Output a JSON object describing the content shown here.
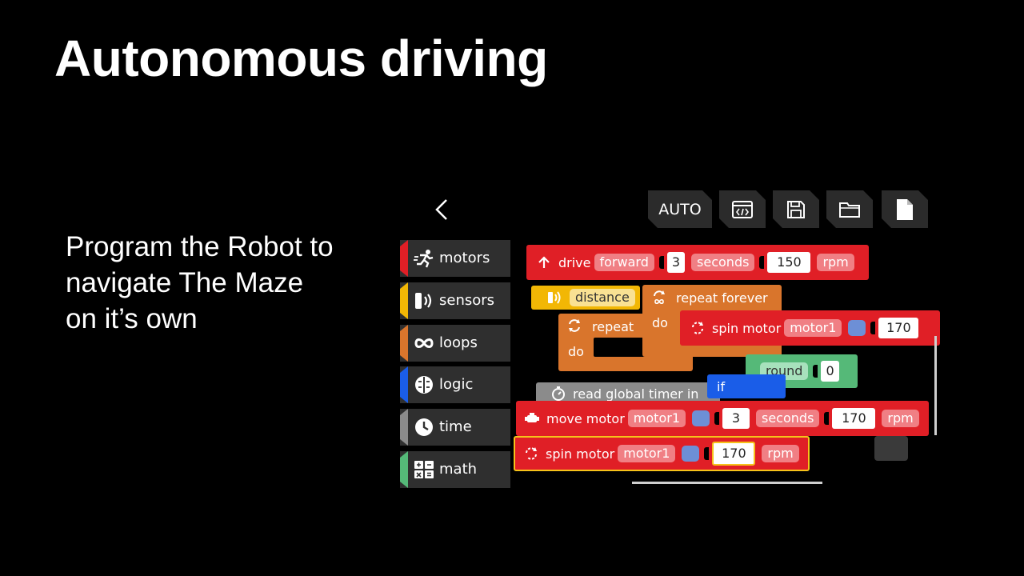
{
  "slide": {
    "title": "Autonomous driving",
    "body_lines": [
      "Program the Robot to",
      "navigate The Maze",
      "on it’s own"
    ]
  },
  "toolbar": {
    "mode_label": "AUTO",
    "icons": [
      "code-icon",
      "save-icon",
      "folder-icon",
      "new-file-icon"
    ]
  },
  "categories": [
    {
      "label": "motors",
      "color": "#e01f26",
      "icon": "running-icon"
    },
    {
      "label": "sensors",
      "color": "#f2b705",
      "icon": "sensor-icon"
    },
    {
      "label": "loops",
      "color": "#d9752c",
      "icon": "infinity-icon"
    },
    {
      "label": "logic",
      "color": "#1a5de8",
      "icon": "brain-icon"
    },
    {
      "label": "time",
      "color": "#8b8b8b",
      "icon": "clock-icon"
    },
    {
      "label": "math",
      "color": "#55b978",
      "icon": "calculator-icon"
    }
  ],
  "blocks": {
    "drive": {
      "label": "drive",
      "direction": "forward",
      "value": "3",
      "unit": "seconds",
      "speed": "150",
      "speed_unit": "rpm"
    },
    "distance": {
      "label": "distance"
    },
    "repeat_forever": {
      "label": "repeat forever",
      "do": "do"
    },
    "repeat": {
      "label": "repeat",
      "do": "do"
    },
    "spin_top": {
      "label": "spin motor",
      "motor": "motor1",
      "speed": "170"
    },
    "round": {
      "label": "round",
      "value": "0"
    },
    "timer": {
      "label": "read global timer in"
    },
    "if": {
      "label": "if"
    },
    "move": {
      "label": "move motor",
      "motor": "motor1",
      "value": "3",
      "unit": "seconds",
      "speed": "170",
      "speed_unit": "rpm"
    },
    "spin_bottom": {
      "label": "spin motor",
      "motor": "motor1",
      "speed": "170",
      "speed_unit": "rpm"
    }
  }
}
